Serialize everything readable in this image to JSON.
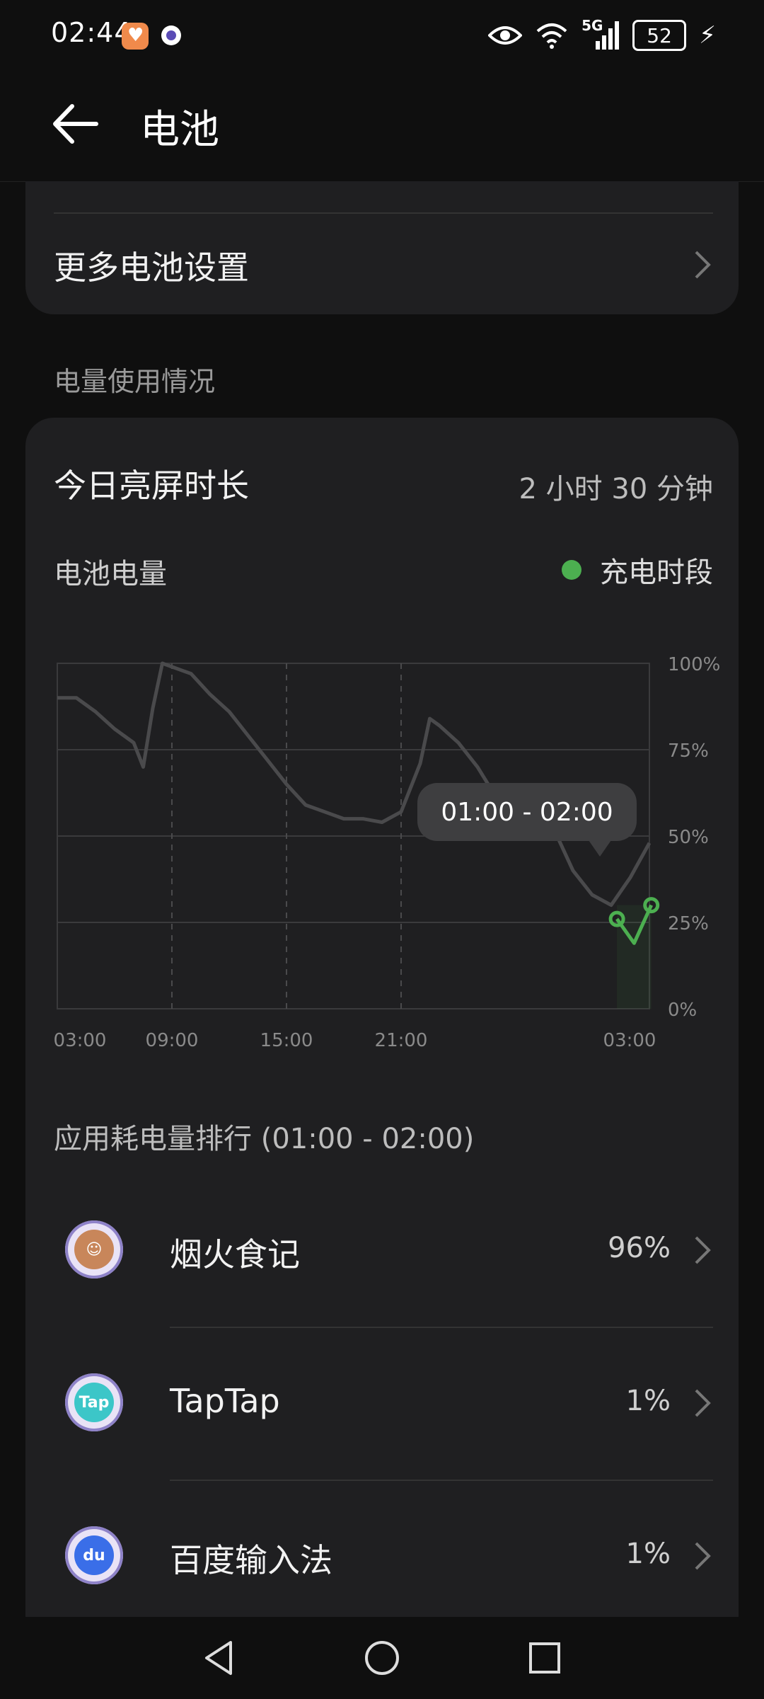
{
  "status_bar": {
    "time": "02:44",
    "network": "5G",
    "battery_level": "52",
    "icons": [
      "app-heart-icon",
      "app-circle-icon",
      "eye-icon",
      "wifi-icon",
      "signal-icon",
      "battery-icon",
      "charging-bolt-icon"
    ]
  },
  "header": {
    "title": "电池",
    "back_icon": "arrow-left-icon"
  },
  "settings": {
    "more_battery_settings": "更多电池设置"
  },
  "usage": {
    "section_label": "电量使用情况",
    "screen_time_label": "今日亮屏时长",
    "screen_time_value": "2 小时 30 分钟",
    "battery_label": "电池电量",
    "charging_legend": "充电时段",
    "colors": {
      "charging": "#4caf50",
      "line": "#4a4a4c",
      "card": "#1f1f21"
    }
  },
  "chart_data": {
    "type": "line",
    "x_tick_labels": [
      "03:00",
      "09:00",
      "15:00",
      "21:00",
      "03:00"
    ],
    "y_tick_labels": [
      "100%",
      "75%",
      "50%",
      "25%",
      "0%"
    ],
    "ylim": [
      0,
      100
    ],
    "x_hours": [
      0,
      1,
      2,
      3,
      4,
      4.5,
      5,
      5.5,
      6,
      6.5,
      7,
      8,
      9,
      10,
      11,
      12,
      13,
      14,
      14.5,
      15,
      16,
      17,
      18,
      19,
      19.5,
      20,
      21,
      22,
      23,
      24,
      25,
      26,
      27,
      28,
      29,
      30,
      31
    ],
    "battery_percent": [
      90,
      90,
      86,
      81,
      77,
      70,
      87,
      100,
      99,
      98,
      97,
      91,
      86,
      79,
      72,
      65,
      59,
      57,
      56,
      55,
      55,
      54,
      57,
      71,
      84,
      82,
      77,
      70,
      61,
      56,
      53,
      52,
      40,
      33,
      30,
      38,
      48
    ],
    "charging_segment": {
      "x_hours": [
        29.3,
        30.2,
        31.1
      ],
      "battery_percent": [
        26,
        19,
        30
      ]
    },
    "selected_range": "01:00 - 02:00",
    "grid": true
  },
  "ranking": {
    "title": "应用耗电量排行 (01:00 - 02:00)",
    "apps": [
      {
        "name": "烟火食记",
        "percent": "96%",
        "icon": "yanhuo-app-icon",
        "color": "#c8865a"
      },
      {
        "name": "TapTap",
        "percent": "1%",
        "icon": "taptap-app-icon",
        "color": "#3cc6c8"
      },
      {
        "name": "百度输入法",
        "percent": "1%",
        "icon": "baidu-input-app-icon",
        "color": "#3a6ee8"
      }
    ]
  },
  "nav_bar": {
    "icons": [
      "back-triangle-icon",
      "home-circle-icon",
      "recents-square-icon"
    ]
  }
}
